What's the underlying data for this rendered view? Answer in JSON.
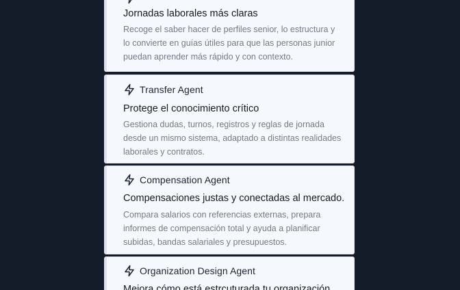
{
  "cards": [
    {
      "agent": "",
      "title": "Jornadas laborales más claras",
      "description": "Recoge el saber hacer de perfiles senior, lo estructura y lo convierte en guías útiles para que las personas junior puedan aprender más rápido y con contexto.",
      "icon": "bolt-icon"
    },
    {
      "agent": "Transfer Agent",
      "title": "Protege el conocimiento crítico",
      "description": "Gestiona dudas, turnos, registros y reglas de jornada desde un mismo sistema, adaptado a distintas realidades laborales y contratos.",
      "icon": "bolt-icon"
    },
    {
      "agent": "Compensation Agent",
      "title": "Compensaciones justas y conectadas al mercado.",
      "description": "Compara salarios con referencias externas, prepara informes de compensación total y ayuda a planificar subidas, bandas salariales y presupuestos.",
      "icon": "bolt-icon"
    },
    {
      "agent": "Organization Design Agent",
      "title": "Mejora cómo está estrcuturada tu organización",
      "description": "",
      "icon": "bolt-icon"
    }
  ],
  "colors": {
    "background": "#151c29",
    "card": "#f5f8fc",
    "title": "#151a22",
    "description": "#757b85"
  }
}
